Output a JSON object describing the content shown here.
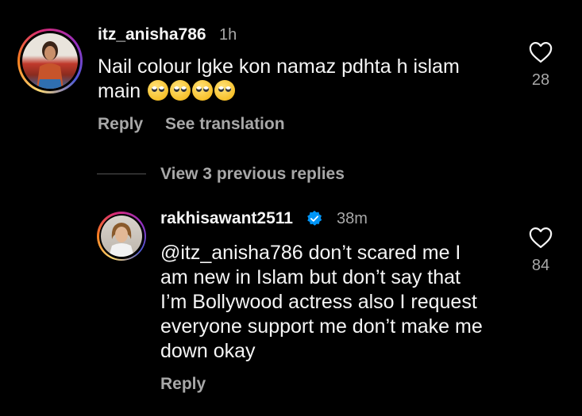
{
  "comment": {
    "username": "itz_anisha786",
    "time": "1h",
    "text_line1": "Nail colour lgke kon namaz pdhta h islam",
    "text_line2": "main",
    "emoji_count": 4,
    "reply_label": "Reply",
    "translate_label": "See translation",
    "likes": "28",
    "icon": "heart-outline-icon"
  },
  "view_replies_label": "View 3 previous replies",
  "reply": {
    "username": "rakhisawant2511",
    "verified_icon": "verified-badge-icon",
    "time": "38m",
    "lines": [
      "@itz_anisha786 don’t scared me I",
      "am new in Islam but don’t say that",
      "I’m Bollywood actress also I request",
      "everyone support me don’t make me",
      "down okay"
    ],
    "reply_label": "Reply",
    "likes": "84",
    "icon": "heart-outline-icon"
  },
  "colors": {
    "background": "#000000",
    "primary_text": "#f5f5f5",
    "secondary_text": "#a8a8a8",
    "verified_blue": "#0095f6"
  }
}
